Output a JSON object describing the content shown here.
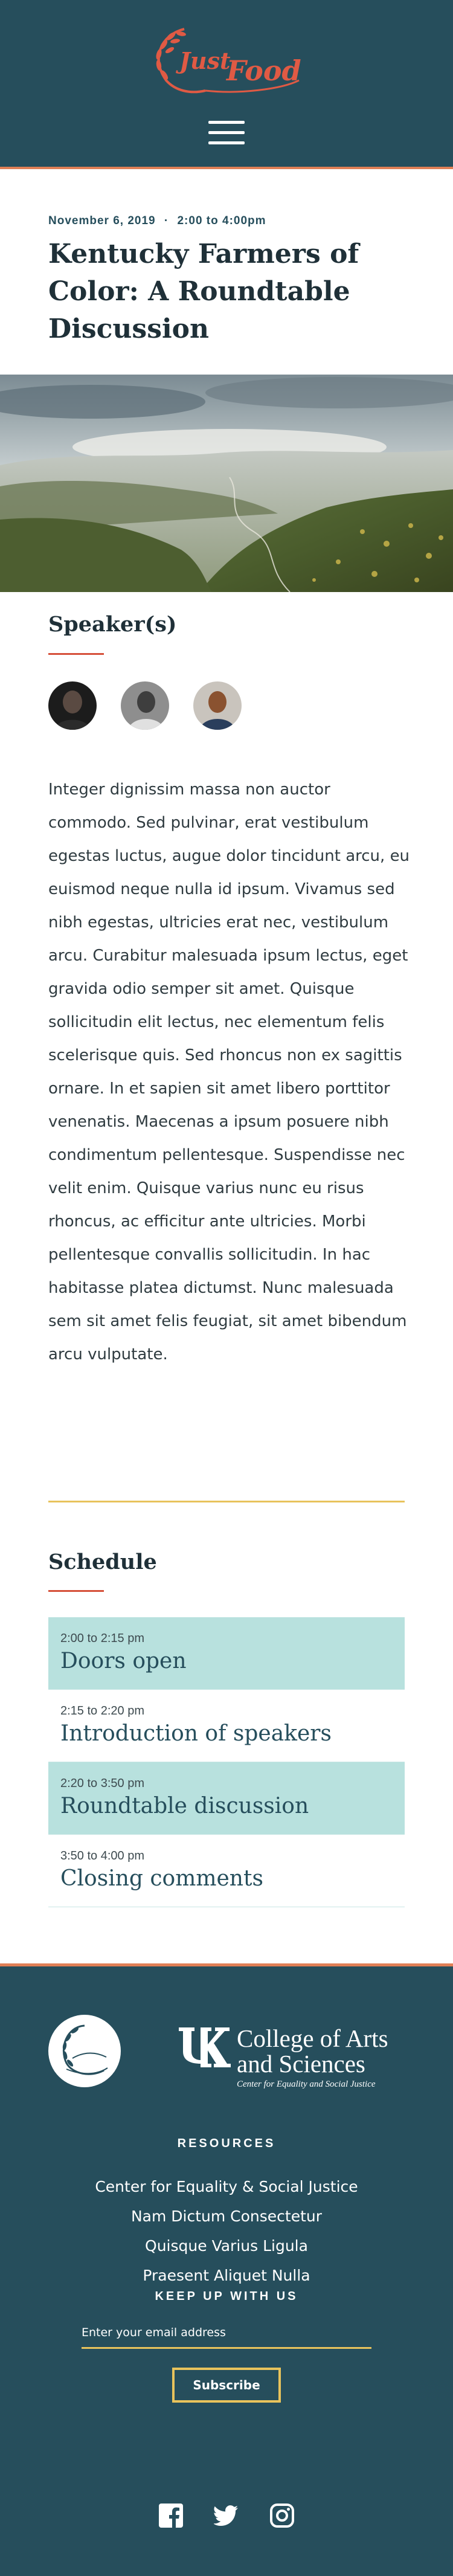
{
  "site": {
    "logo_text_1": "Just",
    "logo_text_2": "Food",
    "menu_icon": "hamburger-menu-icon"
  },
  "event": {
    "date": "November 6, 2019",
    "separator": "·",
    "time": "2:00 to 4:00pm",
    "title": "Kentucky Farmers of Color: A Roundtable Discussion"
  },
  "speakers": {
    "heading": "Speaker(s)",
    "avatars": [
      "speaker-1",
      "speaker-2",
      "speaker-3"
    ]
  },
  "body": {
    "text": "Integer dignissim massa non auctor commodo. Sed pulvinar, erat vestibulum egestas luctus, augue dolor tincidunt arcu, eu euismod neque nulla id ipsum. Vivamus sed nibh egestas, ultricies erat nec, vestibulum arcu. Curabitur malesuada ipsum lectus, eget gravida odio semper sit amet. Quisque sollicitudin elit lectus, nec elementum felis scelerisque quis. Sed rhoncus non ex sagittis ornare. In et sapien sit amet libero porttitor venenatis. Maecenas a ipsum posuere nibh condimentum pellentesque. Suspendisse nec velit enim. Quisque varius nunc eu risus rhoncus, ac efficitur ante ultricies. Morbi pellentesque convallis sollicitudin. In hac habitasse platea dictumst. Nunc malesuada sem sit amet felis feugiat, sit amet bibendum arcu vulputate."
  },
  "schedule": {
    "heading": "Schedule",
    "items": [
      {
        "time": "2:00 to 2:15 pm",
        "title": "Doors open"
      },
      {
        "time": "2:15 to 2:20 pm",
        "title": "Introduction of speakers"
      },
      {
        "time": "2:20 to 3:50 pm",
        "title": "Roundtable discussion"
      },
      {
        "time": "3:50 to 4:00 pm",
        "title": "Closing comments"
      }
    ]
  },
  "footer": {
    "college_line_1": "College of Arts",
    "college_line_2": "and Sciences",
    "college_line_3": "Center for Equality and Social Justice",
    "resources_heading": "RESOURCES",
    "links": [
      "Center for Equality & Social Justice",
      "Nam Dictum Consectetur",
      "Quisque Varius Ligula",
      "Praesent Aliquet Nulla"
    ],
    "newsletter_heading": "KEEP UP WITH US",
    "email_placeholder": "Enter your email address",
    "subscribe_label": "Subscribe",
    "social": [
      "facebook-icon",
      "twitter-icon",
      "instagram-icon"
    ]
  },
  "colors": {
    "header_bg": "#264e5c",
    "accent_orange": "#e07f55",
    "accent_red": "#d6503a",
    "accent_yellow": "#e8c35c",
    "schedule_shade": "#b8e1de"
  }
}
